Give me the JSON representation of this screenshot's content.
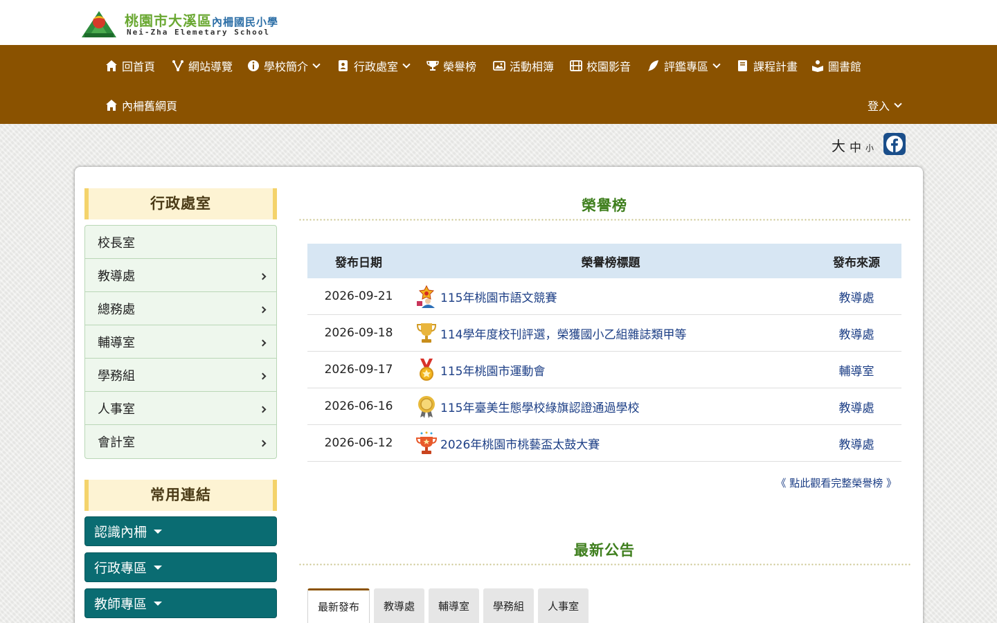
{
  "header": {
    "logo_title_main": "桃園市大溪區",
    "logo_title_sub": "內柵國民小學",
    "logo_en": "Nei-Zha Elemetary School"
  },
  "nav": {
    "items": [
      {
        "label": "回首頁",
        "icon": "home-icon"
      },
      {
        "label": "網站導覽",
        "icon": "sitemap-icon"
      },
      {
        "label": "學校簡介",
        "icon": "info-icon"
      },
      {
        "label": "行政處室",
        "icon": "contact-card-icon"
      },
      {
        "label": "榮譽榜",
        "icon": "trophy-icon"
      },
      {
        "label": "活動相簿",
        "icon": "photo-icon"
      },
      {
        "label": "校園影音",
        "icon": "film-icon"
      },
      {
        "label": "評鑑專區",
        "icon": "feather-icon"
      },
      {
        "label": "課程計畫",
        "icon": "book-icon"
      },
      {
        "label": "圖書館",
        "icon": "reader-icon"
      },
      {
        "label": "內柵舊網頁",
        "icon": "home-icon"
      }
    ],
    "login": "登入"
  },
  "font_size": {
    "large": "大",
    "medium": "中",
    "small": "小"
  },
  "sidebar": {
    "admin_title": "行政處室",
    "admin_items": [
      "校長室",
      "教導處",
      "總務處",
      "輔導室",
      "學務組",
      "人事室",
      "會計室"
    ],
    "links_title": "常用連結",
    "link_buttons": [
      "認識內柵",
      "行政專區",
      "教師專區"
    ]
  },
  "honor": {
    "title": "榮譽榜",
    "headers": {
      "date": "發布日期",
      "title": "榮譽榜標題",
      "source": "發布來源"
    },
    "rows": [
      {
        "date": "2026-09-21",
        "title": "115年桃園市語文競賽",
        "source": "教導處"
      },
      {
        "date": "2026-09-18",
        "title": "114學年度校刊評選，榮獲國小乙組雜誌類甲等",
        "source": "教導處"
      },
      {
        "date": "2026-09-17",
        "title": "115年桃園市運動會",
        "source": "輔導室"
      },
      {
        "date": "2026-06-16",
        "title": "115年臺美生態學校綠旗認證通過學校",
        "source": "教導處"
      },
      {
        "date": "2026-06-12",
        "title": "2026年桃園市桃藝盃太鼓大賽",
        "source": "教導處"
      }
    ],
    "more": "《 點此觀看完整榮譽榜 》"
  },
  "news": {
    "title": "最新公告",
    "tabs": [
      "最新發布",
      "教導處",
      "輔導室",
      "學務組",
      "人事室"
    ]
  },
  "colors": {
    "nav_bg": "#8a5200",
    "link_btn": "#0a6c72",
    "section_title": "#3f7f1e",
    "table_head": "#d7e6f3"
  }
}
